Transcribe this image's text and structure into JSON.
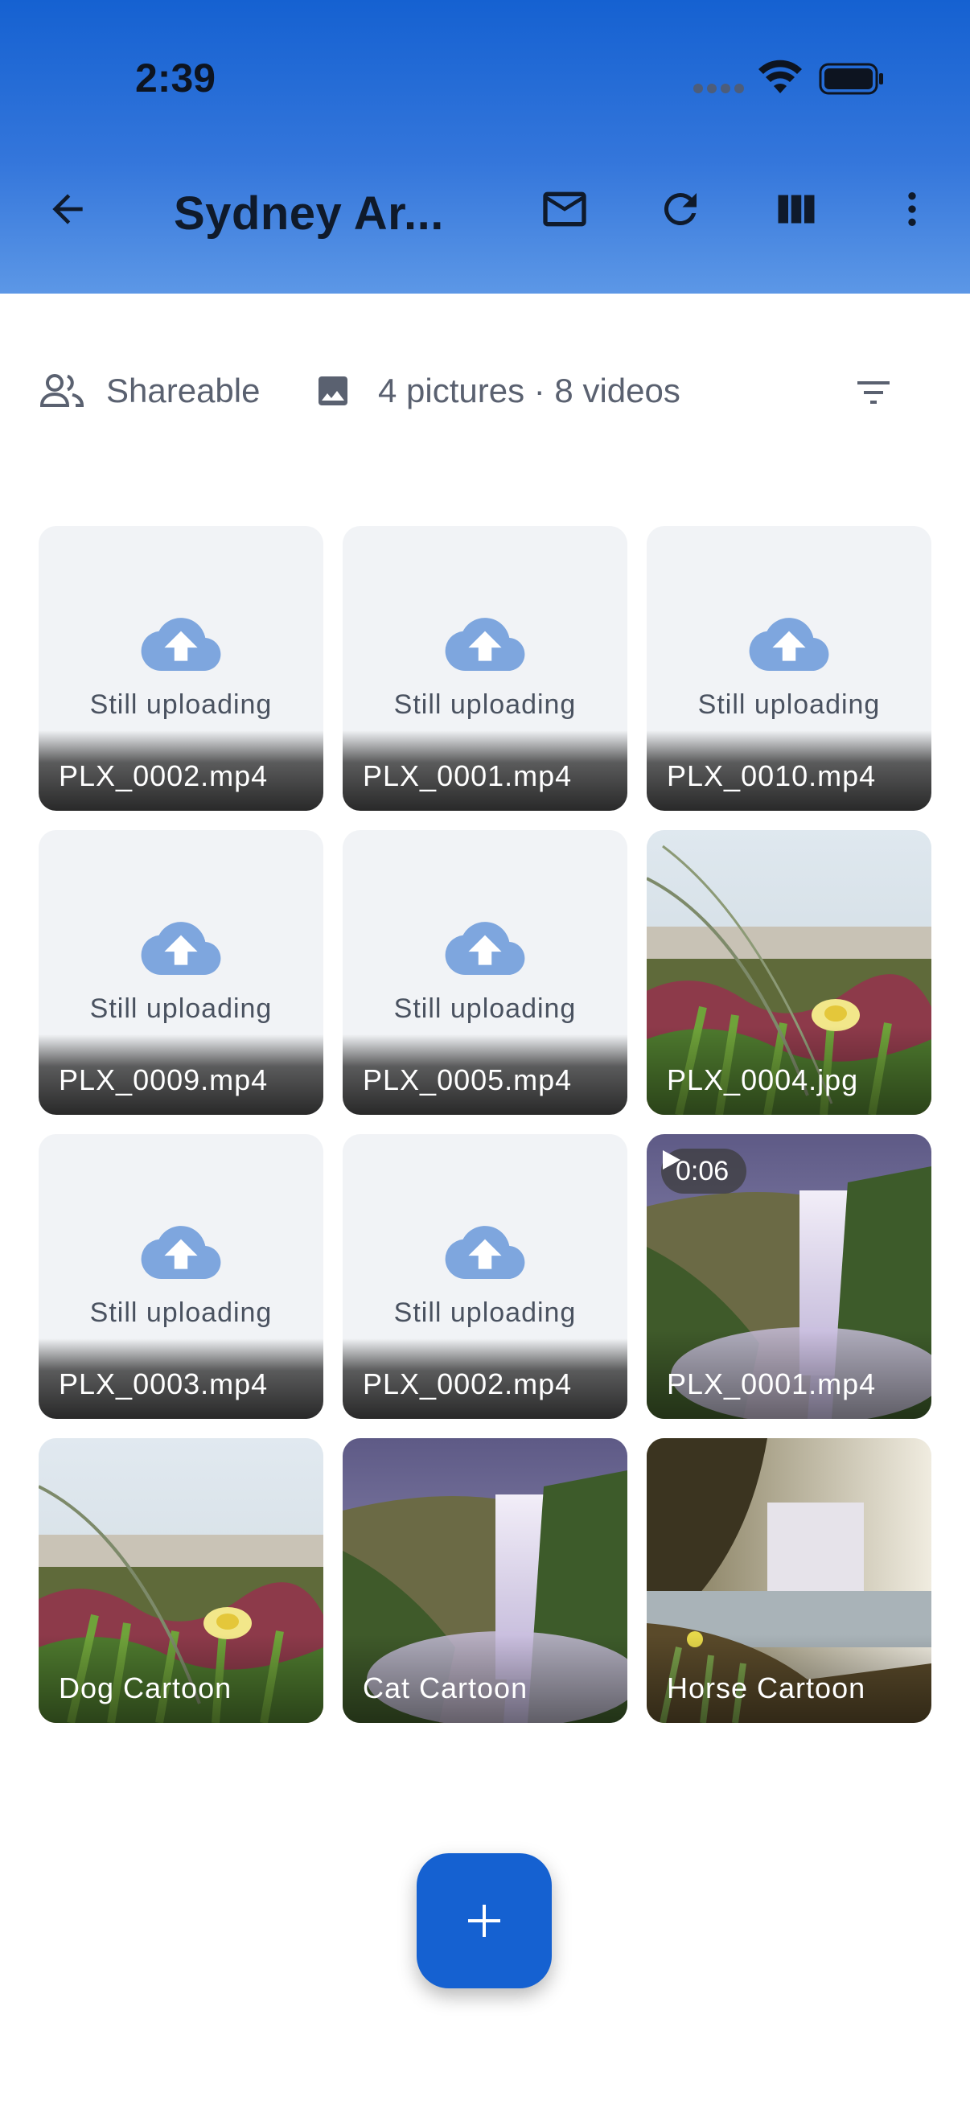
{
  "status_bar": {
    "time": "2:39"
  },
  "header": {
    "title": "Sydney Ar..."
  },
  "info": {
    "shareable": "Shareable",
    "counts": "4 pictures · 8 videos"
  },
  "grid": {
    "uploading_text": "Still uploading",
    "items": [
      {
        "name": "PLX_0002.mp4"
      },
      {
        "name": "PLX_0001.mp4"
      },
      {
        "name": "PLX_0010.mp4"
      },
      {
        "name": "PLX_0009.mp4"
      },
      {
        "name": "PLX_0005.mp4"
      },
      {
        "name": "PLX_0004.jpg"
      },
      {
        "name": "PLX_0003.mp4"
      },
      {
        "name": "PLX_0002.mp4"
      },
      {
        "name": "PLX_0001.mp4",
        "duration": "0:06"
      },
      {
        "name": "Dog Cartoon"
      },
      {
        "name": "Cat Cartoon"
      },
      {
        "name": "Horse Cartoon"
      }
    ]
  },
  "colors": {
    "primary": "#1561d1",
    "tile_bg": "#f1f3f6",
    "upload_icon": "#7ea6de"
  }
}
